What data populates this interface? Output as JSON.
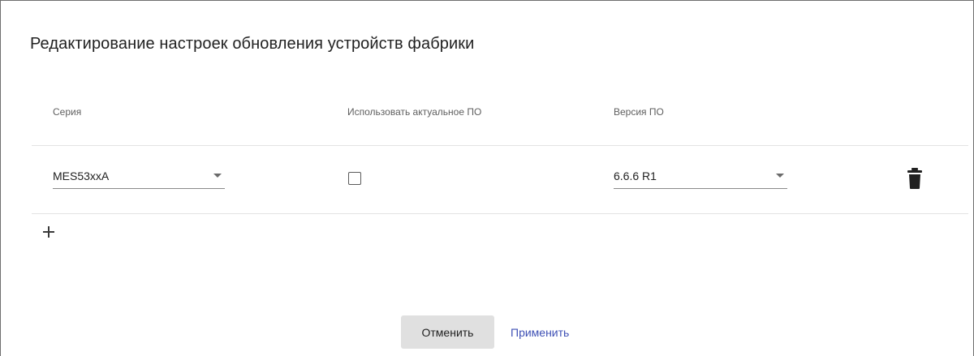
{
  "dialog": {
    "title": "Редактирование настроек обновления устройств фабрики"
  },
  "table": {
    "headers": {
      "series": "Серия",
      "use_actual": "Использовать актуальное ПО",
      "version": "Версия ПО"
    },
    "rows": [
      {
        "series": "MES53xxA",
        "use_actual": false,
        "version": "6.6.6 R1"
      }
    ]
  },
  "icons": {
    "delete": "trash-icon",
    "add": "plus-icon",
    "dropdown": "caret-down-icon"
  },
  "actions": {
    "cancel_label": "Отменить",
    "apply_label": "Применить"
  },
  "colors": {
    "primary": "#3f51b5",
    "cancel_bg": "#e0e0e0"
  }
}
